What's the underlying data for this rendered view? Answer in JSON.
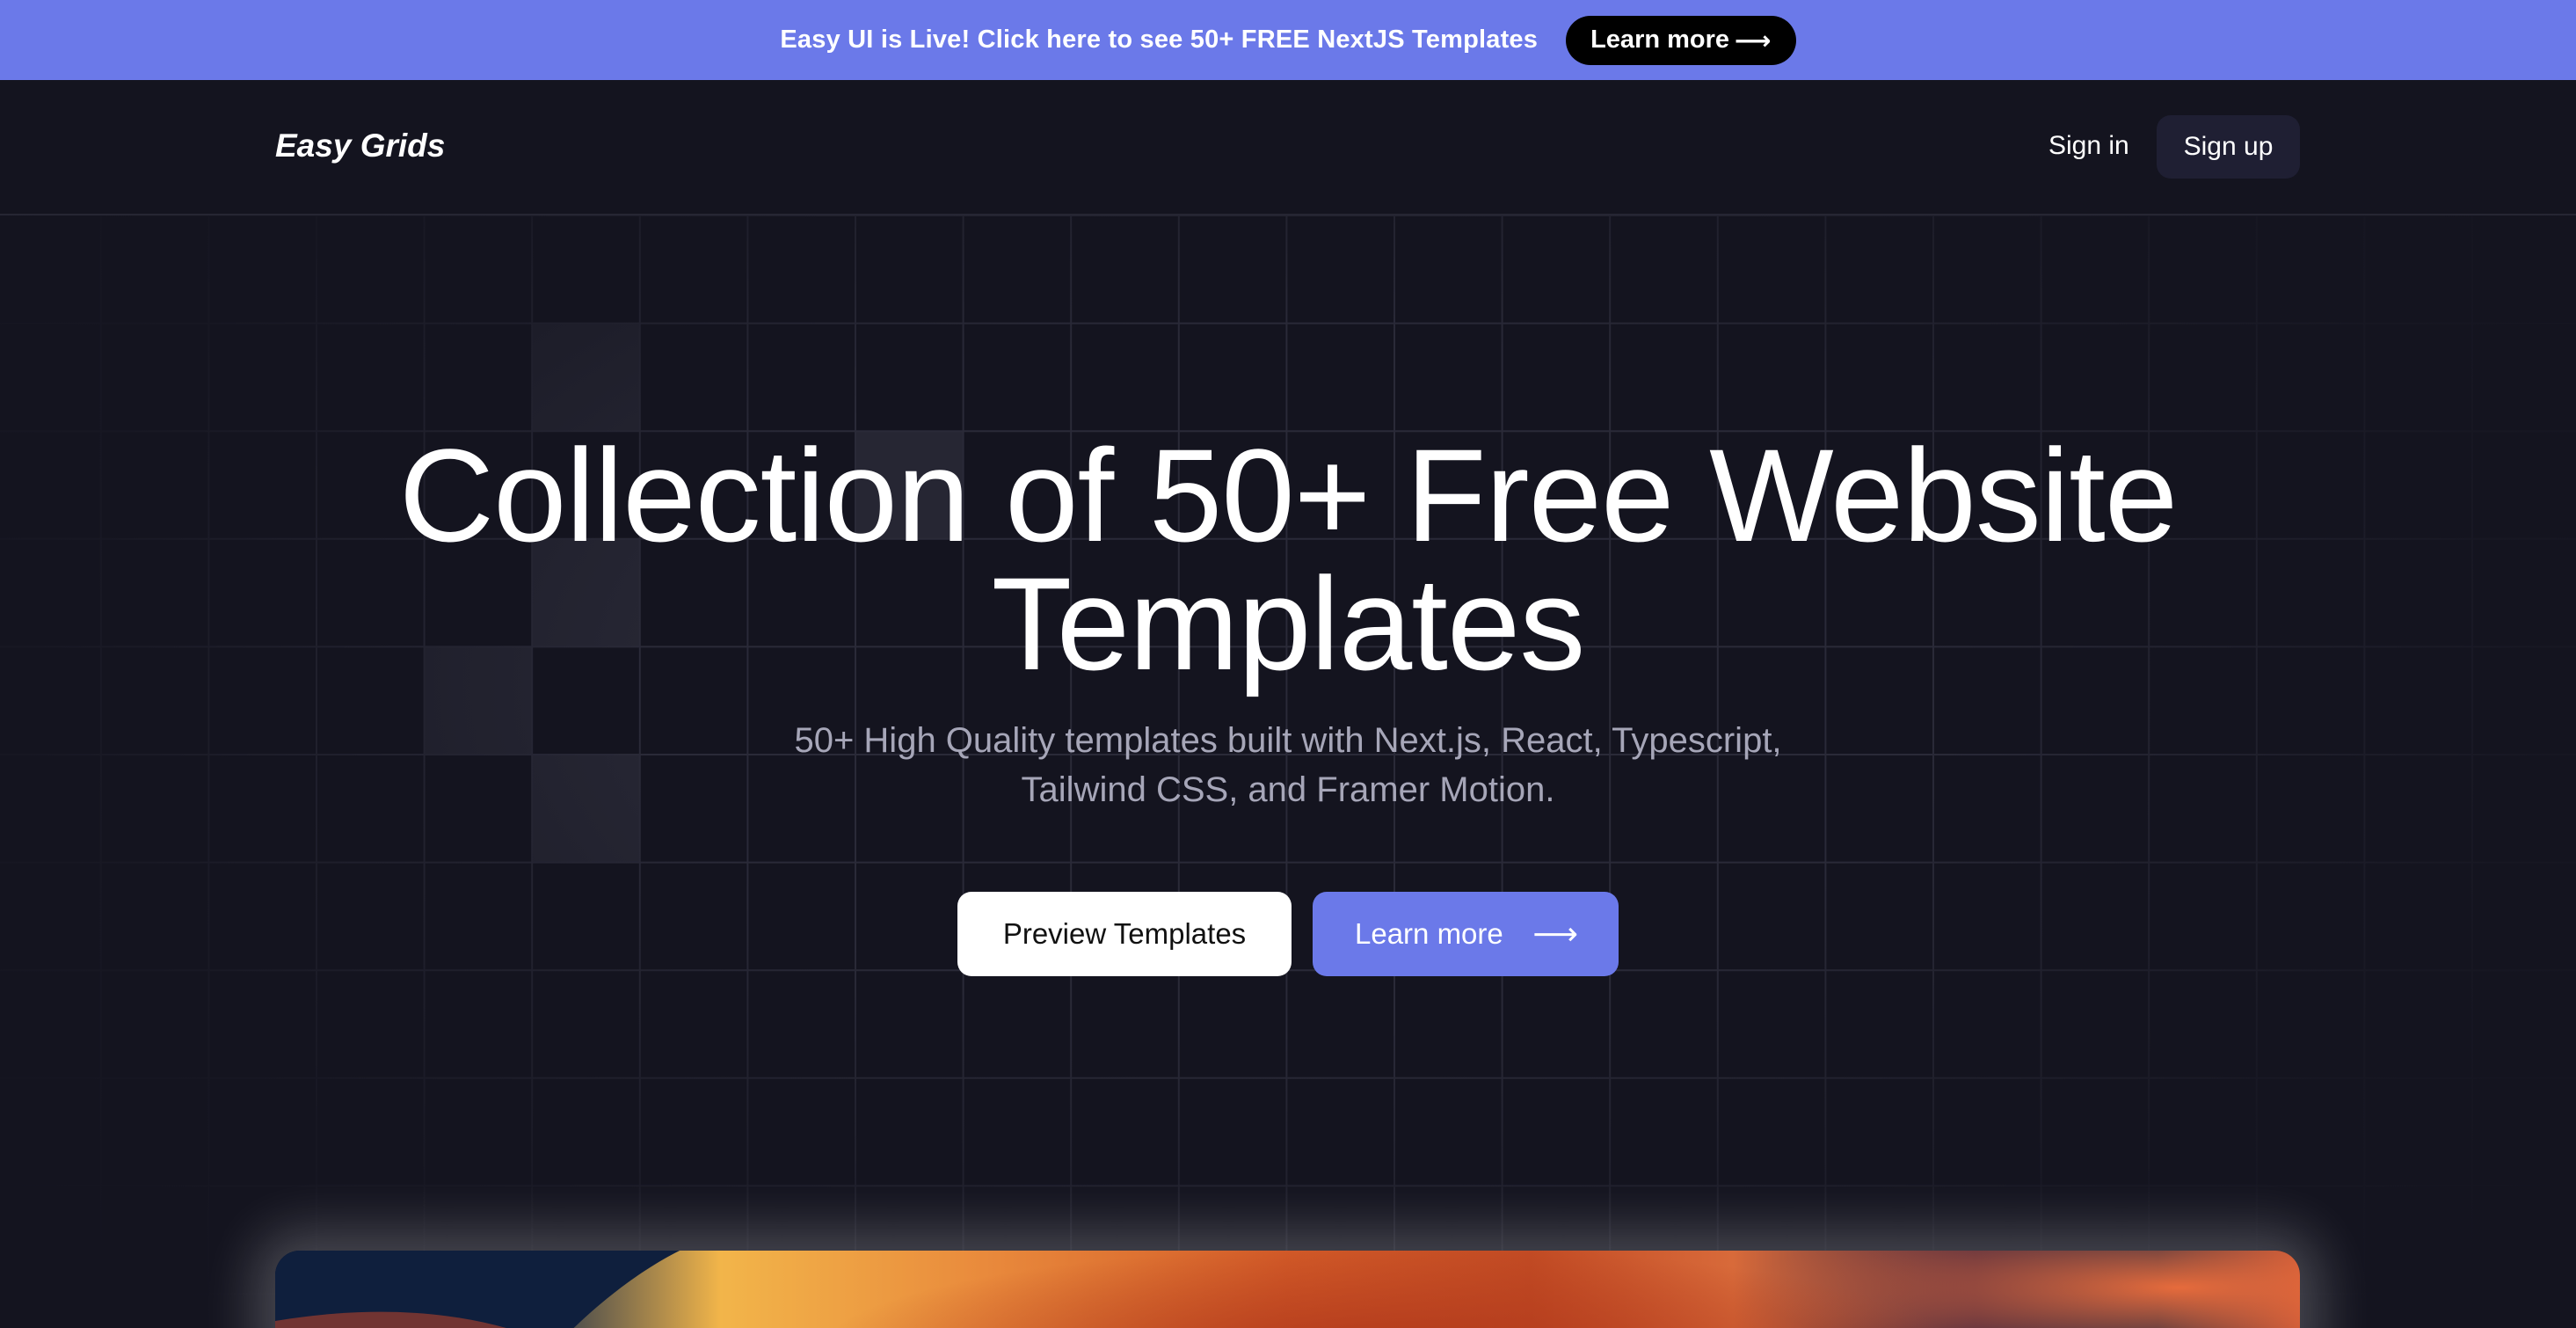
{
  "announcement": {
    "text": "Easy UI is Live! Click here to see 50+ FREE NextJS Templates",
    "button_label": "Learn more",
    "button_arrow": "⟶",
    "bg_color": "#6b79e9"
  },
  "navbar": {
    "logo": "Easy Grids",
    "signin_label": "Sign in",
    "signup_label": "Sign up"
  },
  "hero": {
    "title_line1": "Collection of 50+ Free Website",
    "title_line2": "Templates",
    "subtitle_line1": "50+ High Quality templates built with Next.js, React, Typescript,",
    "subtitle_line2": "Tailwind CSS, and Framer Motion.",
    "preview_button_label": "Preview Templates",
    "learn_button_label": "Learn more",
    "learn_button_arrow": "⟶"
  },
  "colors": {
    "background": "#14141f",
    "accent": "#6b79e9",
    "grid_line": "#2a2a38",
    "highlight_cell": "#262633"
  },
  "icons": {
    "arrow": "arrow-right-icon"
  }
}
